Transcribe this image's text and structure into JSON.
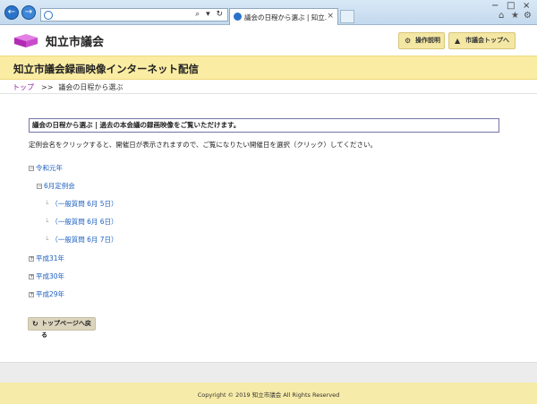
{
  "browser": {
    "tab_title": "議会の日程から選ぶ | 知立...",
    "tab_close": "×",
    "address_tools": "⌕ ▾ ↻",
    "window_controls": {
      "minimize": "−",
      "maximize": "□",
      "close": "×"
    },
    "icons": {
      "back": "back-arrow-icon",
      "forward": "forward-arrow-icon",
      "home": "⌂",
      "star": "★",
      "gear": "⚙"
    }
  },
  "header": {
    "logo_text": "知立市議会",
    "help_button": "操作説明",
    "help_icon": "⚙",
    "council_top_button": "市議会トップへ",
    "council_top_icon": "▲"
  },
  "title_band": {
    "title": "知立市議会録画映像インターネット配信"
  },
  "breadcrumb": {
    "top": "トップ",
    "separator": ">>",
    "current": "議会の日程から選ぶ"
  },
  "main": {
    "info_box": "議会の日程から選ぶ | 過去の本会議の録画映像をご覧いただけます。",
    "description": "定例会名をクリックすると、開催日が表示されますので、ご覧になりたい開催日を選択（クリック）してください。",
    "tree": [
      {
        "label": "令和元年",
        "toggle": "−"
      },
      {
        "label": "6月定例会",
        "toggle": "−"
      },
      {
        "label": "（一般質問 6月 5日）",
        "branch": "└"
      },
      {
        "label": "（一般質問 6月 6日）",
        "branch": "└"
      },
      {
        "label": "（一般質問 6月 7日）",
        "branch": "└"
      },
      {
        "label": "平成31年",
        "toggle": "+"
      },
      {
        "label": "平成30年",
        "toggle": "+"
      },
      {
        "label": "平成29年",
        "toggle": "+"
      }
    ],
    "back_button": "トップページへ戻る",
    "back_icon": "↻"
  },
  "footer": {
    "copyright": "Copyright © 2019 知立市議会 All Rights Reserved"
  },
  "colors": {
    "title_band": "#faeca2",
    "footer": "#f7eba9",
    "link": "#1d5fbf",
    "logo": "#c02fc0"
  }
}
